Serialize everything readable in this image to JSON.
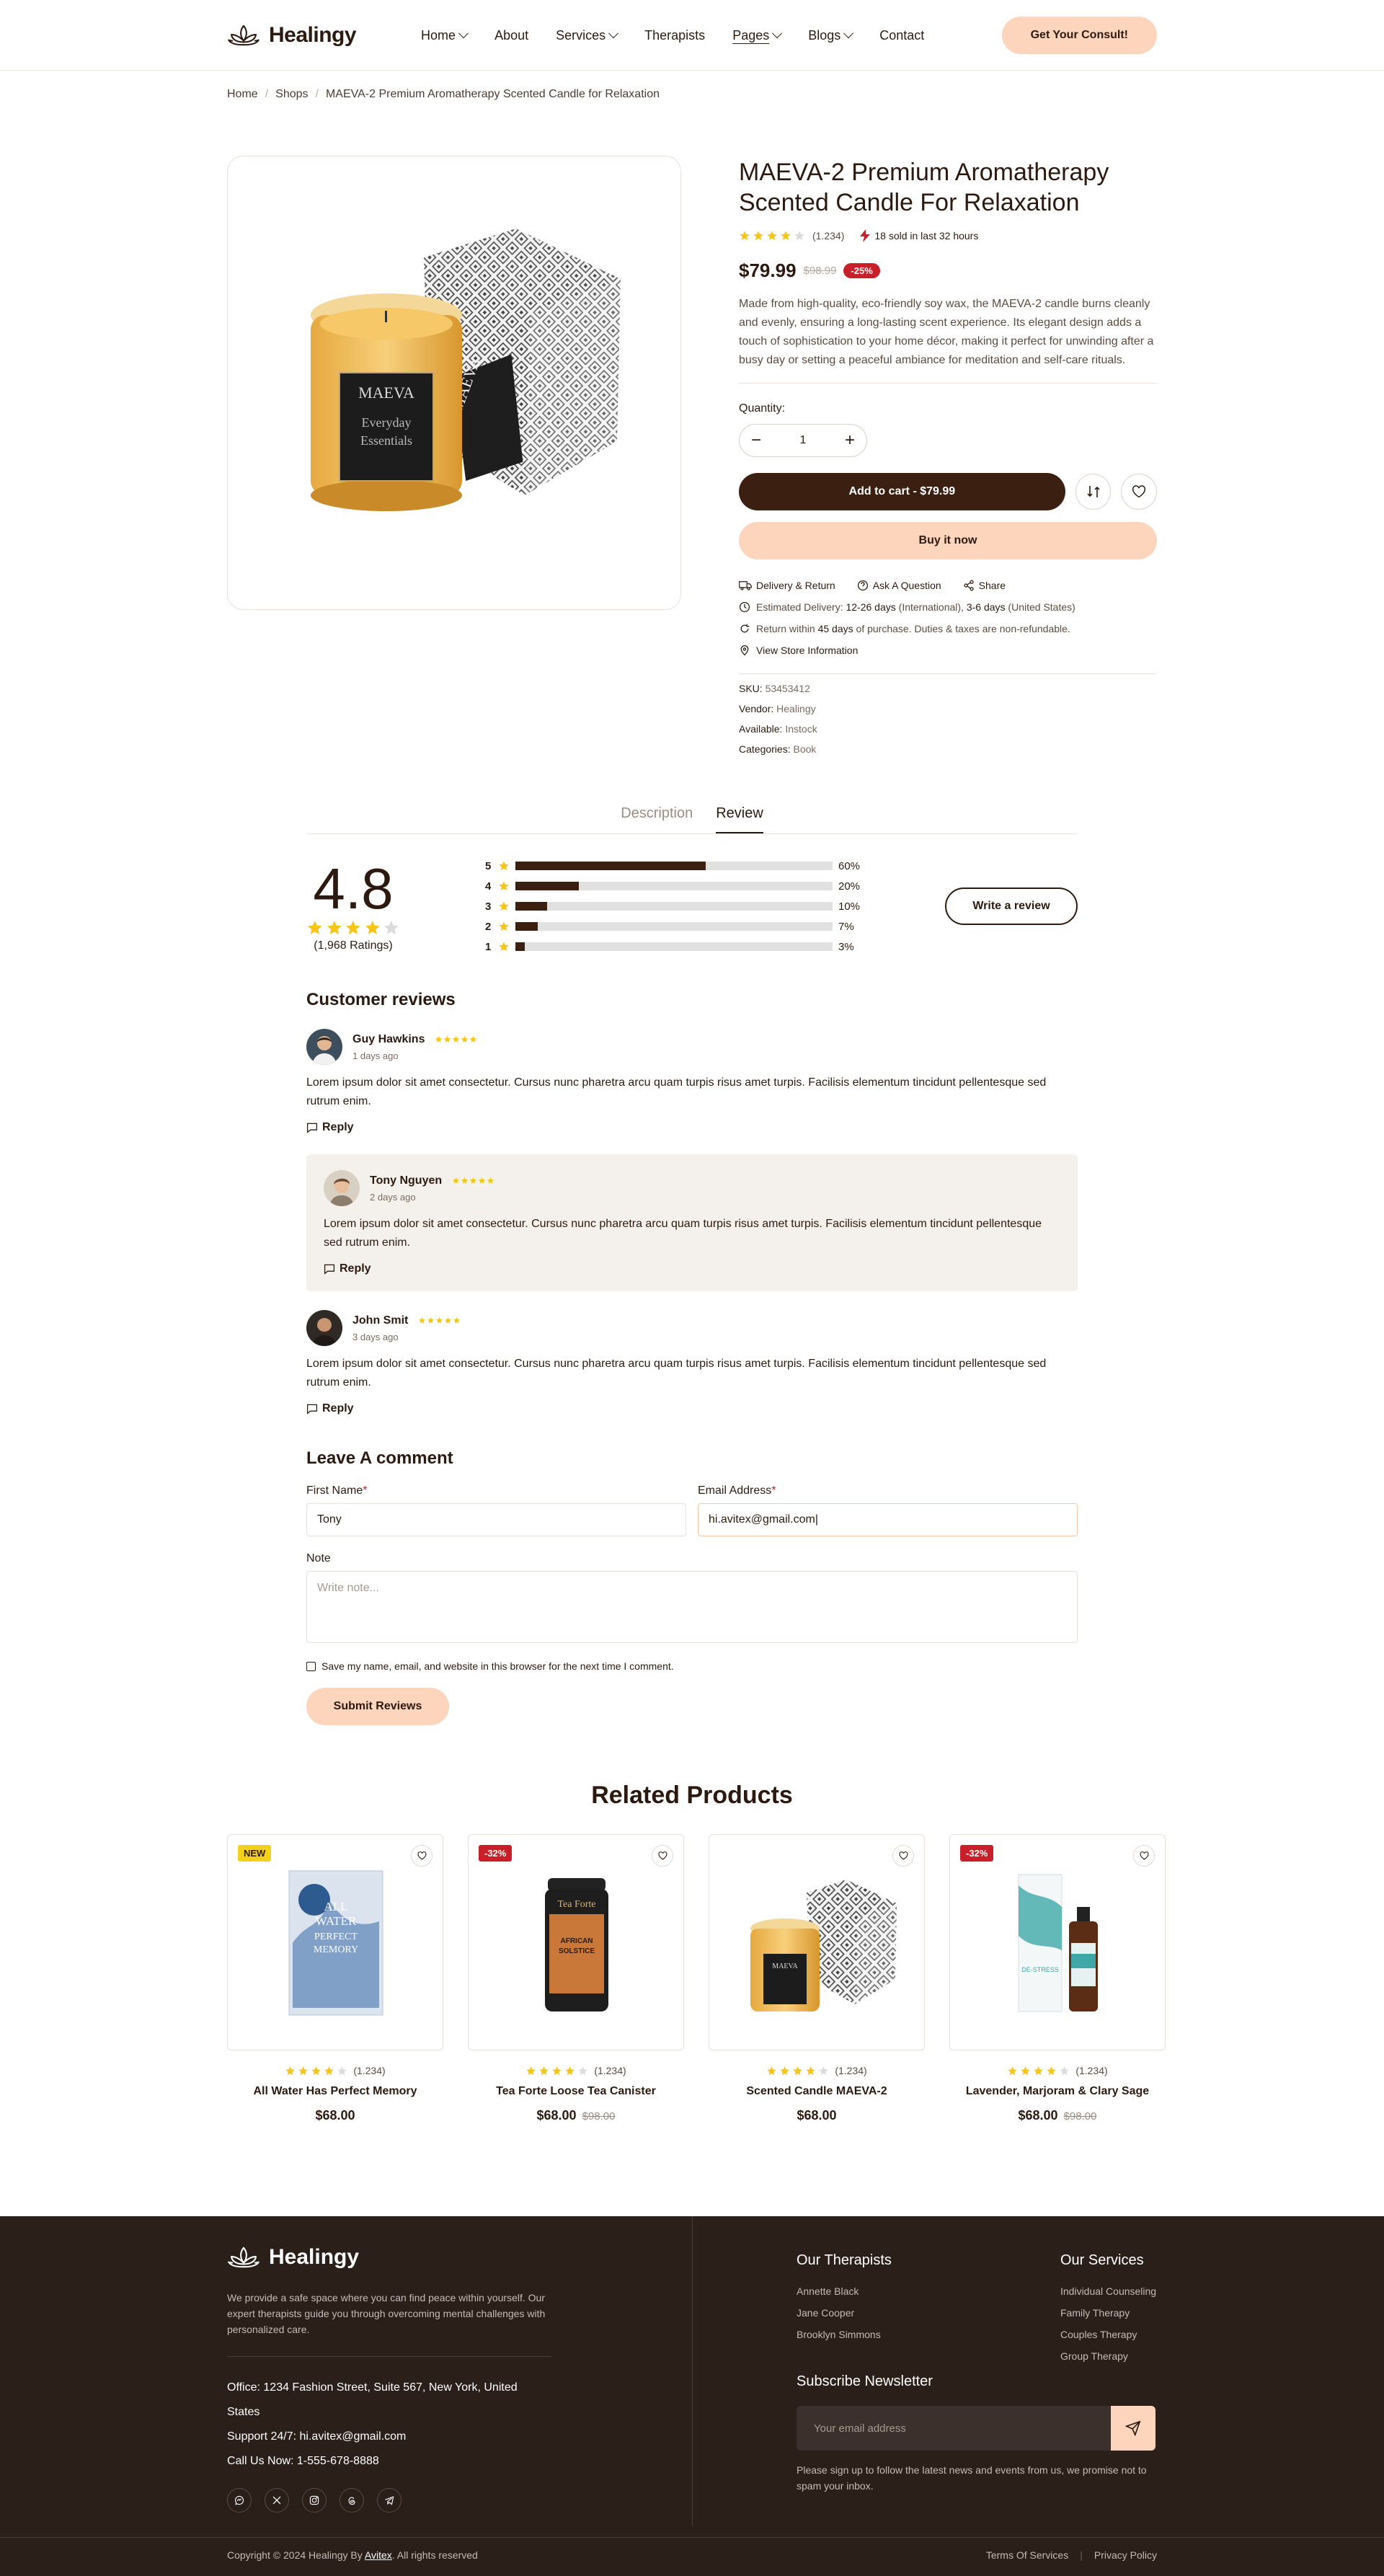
{
  "header": {
    "brand": "Healingy",
    "nav": [
      {
        "label": "Home"
      },
      {
        "label": "About"
      },
      {
        "label": "Services"
      },
      {
        "label": "Therapists"
      },
      {
        "label": "Pages"
      },
      {
        "label": "Blogs"
      },
      {
        "label": "Contact"
      }
    ],
    "cta": "Get Your Consult!"
  },
  "breadcrumb": [
    "Home",
    "Shops",
    "MAEVA-2 Premium Aromatherapy Scented Candle for Relaxation"
  ],
  "product": {
    "title": "MAEVA-2 Premium Aromatherapy Scented Candle For Relaxation",
    "rating": 4,
    "review_count": "(1.234)",
    "sold_text": "18 sold in last 32 hours",
    "price": "$79.99",
    "old_price": "$98.99",
    "discount": "-25%",
    "description": "Made from high-quality, eco-friendly soy wax, the MAEVA-2 candle burns cleanly and evenly, ensuring a long-lasting scent experience. Its elegant design adds a touch of sophistication to your home décor, making it perfect for unwinding after a busy day or setting a peaceful ambiance for meditation and self-care rituals.",
    "quantity_label": "Quantity:",
    "quantity": "1",
    "add_to_cart": "Add to cart - $79.99",
    "buy_now": "Buy it now",
    "links": [
      "Delivery & Return",
      "Ask A Question",
      "Share"
    ],
    "delivery_prefix": "Estimated Delivery:",
    "delivery_intl_days": "12-26 days",
    "delivery_intl_label": "(International),",
    "delivery_us_days": "3-6 days",
    "delivery_us_label": "(United States)",
    "return_prefix": "Return within",
    "return_days": "45 days",
    "return_suffix": "of purchase. Duties & taxes are non-refundable.",
    "store_info": "View Store Information",
    "specs": [
      {
        "label": "SKU:",
        "value": "53453412"
      },
      {
        "label": "Vendor:",
        "value": "Healingy"
      },
      {
        "label": "Available:",
        "value": "Instock"
      },
      {
        "label": "Categories:",
        "value": "Book"
      }
    ]
  },
  "tabs": [
    "Description",
    "Review"
  ],
  "review_summary": {
    "score": "4.8",
    "stars": 4,
    "ratings_text": "(1,968 Ratings)",
    "breakdown": [
      {
        "star": "5",
        "percent": 60,
        "label": "60%"
      },
      {
        "star": "4",
        "percent": 20,
        "label": "20%"
      },
      {
        "star": "3",
        "percent": 10,
        "label": "10%"
      },
      {
        "star": "2",
        "percent": 7,
        "label": "7%"
      },
      {
        "star": "1",
        "percent": 3,
        "label": "3%"
      }
    ],
    "write_review": "Write a review"
  },
  "customer_reviews": {
    "heading": "Customer reviews",
    "reply_label": "Reply",
    "items": [
      {
        "name": "Guy Hawkins",
        "date": "1 days ago",
        "body": "Lorem ipsum dolor sit amet consectetur. Cursus nunc pharetra arcu quam turpis risus amet turpis. Facilisis elementum tincidunt pellentesque sed rutrum enim."
      },
      {
        "name": "Tony Nguyen",
        "date": "2 days ago",
        "body": "Lorem ipsum dolor sit amet consectetur. Cursus nunc pharetra arcu quam turpis risus amet turpis. Facilisis elementum tincidunt pellentesque sed rutrum enim."
      },
      {
        "name": "John Smit",
        "date": "3 days ago",
        "body": "Lorem ipsum dolor sit amet consectetur. Cursus nunc pharetra arcu quam turpis risus amet turpis. Facilisis elementum tincidunt pellentesque sed rutrum enim."
      }
    ]
  },
  "comment_form": {
    "heading": "Leave A comment",
    "first_name_label": "First Name",
    "first_name_value": "Tony",
    "email_label": "Email Address",
    "email_value": "hi.avitex@gmail.com|",
    "note_label": "Note",
    "note_placeholder": "Write note...",
    "save_label": "Save my name, email, and website in this browser for the next time I comment.",
    "submit": "Submit Reviews"
  },
  "related": {
    "heading": "Related Products",
    "items": [
      {
        "badge": "NEW",
        "title": "All Water Has Perfect Memory",
        "price": "$68.00",
        "old_price": "",
        "count": "(1.234)"
      },
      {
        "badge": "-32%",
        "title": "Tea Forte Loose Tea Canister",
        "price": "$68.00",
        "old_price": "$98.00",
        "count": "(1.234)"
      },
      {
        "badge": "",
        "title": "Scented Candle MAEVA-2",
        "price": "$68.00",
        "old_price": "",
        "count": "(1.234)"
      },
      {
        "badge": "-32%",
        "title": "Lavender, Marjoram & Clary Sage",
        "price": "$68.00",
        "old_price": "$98.00",
        "count": "(1.234)"
      }
    ]
  },
  "footer": {
    "brand": "Healingy",
    "about": "We provide a safe space where you can find peace within yourself. Our expert therapists guide you through overcoming mental challenges with personalized care.",
    "office": "Office: 1234 Fashion Street, Suite 567, New York, United States",
    "support": "Support 24/7: hi.avitex@gmail.com",
    "call": "Call Us Now: 1-555-678-8888",
    "therapists_heading": "Our Therapists",
    "therapists": [
      "Annette Black",
      "Jane Cooper",
      "Brooklyn Simmons"
    ],
    "services_heading": "Our Services",
    "services": [
      "Individual Counseling",
      "Family Therapy",
      "Couples Therapy",
      "Group Therapy"
    ],
    "newsletter_heading": "Subscribe Newsletter",
    "newsletter_placeholder": "Your email address",
    "newsletter_note": "Please sign up to follow the latest news and events from us, we promise not to spam your inbox.",
    "copyright_prefix": "Copyright © 2024 Healingy By",
    "copyright_brand": "Avitex",
    "copyright_suffix": ". All rights reserved",
    "terms": "Terms Of Services",
    "privacy": "Privacy Policy"
  },
  "colors": {
    "primary": "#3b2011",
    "peach": "#fdd5bd",
    "star": "#f5c518",
    "sale": "#c8202b",
    "footer_bg": "#2b1f1a"
  }
}
